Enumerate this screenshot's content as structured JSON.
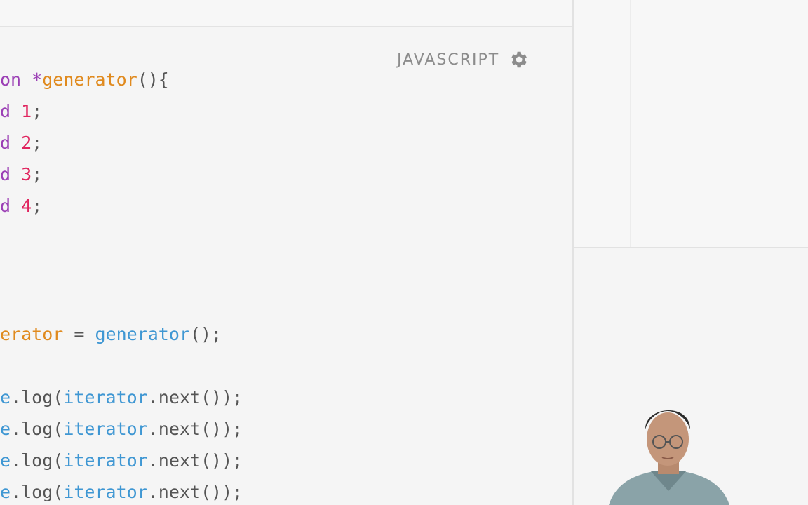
{
  "editor": {
    "language_label": "JAVASCRIPT",
    "settings_icon": "gear-icon",
    "lines": [
      {
        "segments": [
          {
            "t": "on ",
            "c": "kw"
          },
          {
            "t": "*",
            "c": "kw"
          },
          {
            "t": "generator",
            "c": "fn"
          },
          {
            "t": "(){",
            "c": "pl"
          }
        ]
      },
      {
        "segments": [
          {
            "t": "d ",
            "c": "kw"
          },
          {
            "t": "1",
            "c": "num"
          },
          {
            "t": ";",
            "c": "pl"
          }
        ]
      },
      {
        "segments": [
          {
            "t": "d ",
            "c": "kw"
          },
          {
            "t": "2",
            "c": "num"
          },
          {
            "t": ";",
            "c": "pl"
          }
        ]
      },
      {
        "segments": [
          {
            "t": "d ",
            "c": "kw"
          },
          {
            "t": "3",
            "c": "num"
          },
          {
            "t": ";",
            "c": "pl"
          }
        ]
      },
      {
        "segments": [
          {
            "t": "d ",
            "c": "kw"
          },
          {
            "t": "4",
            "c": "num"
          },
          {
            "t": ";",
            "c": "pl"
          }
        ]
      },
      {
        "segments": [
          {
            "t": "erator",
            "c": "fn"
          },
          {
            "t": " = ",
            "c": "op"
          },
          {
            "t": "generator",
            "c": "call"
          },
          {
            "t": "();",
            "c": "pl"
          }
        ]
      },
      {
        "segments": [
          {
            "t": "e",
            "c": "obj"
          },
          {
            "t": ".log(",
            "c": "pl"
          },
          {
            "t": "iterator",
            "c": "obj"
          },
          {
            "t": ".next());",
            "c": "pl"
          }
        ]
      },
      {
        "segments": [
          {
            "t": "e",
            "c": "obj"
          },
          {
            "t": ".log(",
            "c": "pl"
          },
          {
            "t": "iterator",
            "c": "obj"
          },
          {
            "t": ".next());",
            "c": "pl"
          }
        ]
      },
      {
        "segments": [
          {
            "t": "e",
            "c": "obj"
          },
          {
            "t": ".log(",
            "c": "pl"
          },
          {
            "t": "iterator",
            "c": "obj"
          },
          {
            "t": ".next());",
            "c": "pl"
          }
        ]
      },
      {
        "segments": [
          {
            "t": "e",
            "c": "obj"
          },
          {
            "t": ".log(",
            "c": "pl"
          },
          {
            "t": "iterator",
            "c": "obj"
          },
          {
            "t": ".next());",
            "c": "pl"
          }
        ]
      }
    ]
  },
  "colors": {
    "keyword": "#9b3fb5",
    "function_name": "#e08a1e",
    "number": "#e0245e",
    "call": "#3f97d3",
    "plain": "#555555"
  },
  "webcam_icon": "presenter-webcam"
}
